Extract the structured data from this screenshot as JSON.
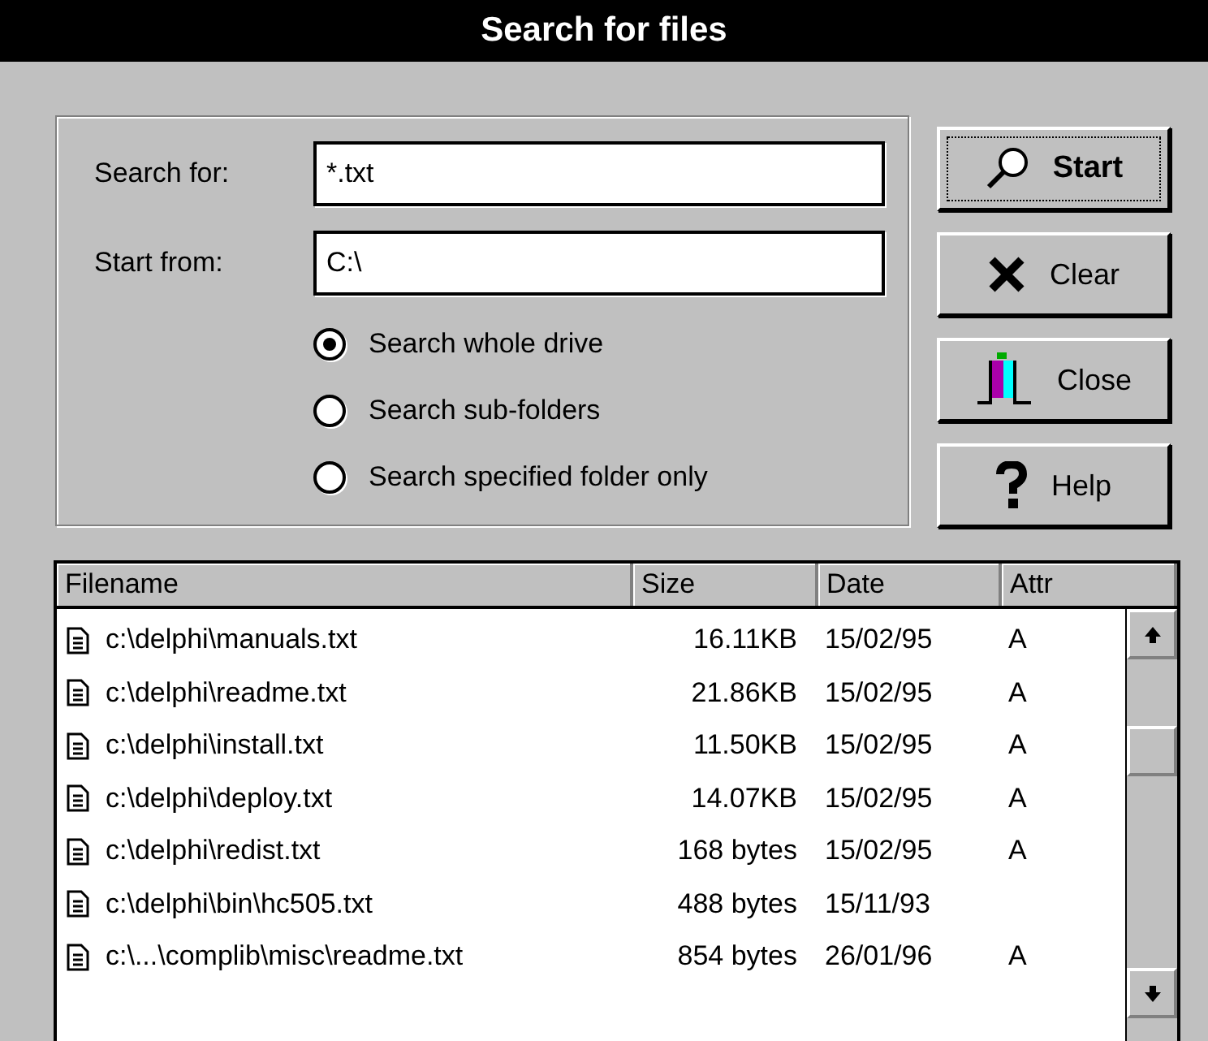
{
  "window": {
    "title": "Search for files"
  },
  "fields": [
    {
      "label": "Search for:",
      "value": "*.txt"
    },
    {
      "label": "Start from:",
      "value": "C:\\"
    }
  ],
  "options": [
    {
      "label": "Search whole drive",
      "selected": true
    },
    {
      "label": "Search sub-folders",
      "selected": false
    },
    {
      "label": "Search specified folder only",
      "selected": false
    }
  ],
  "buttons": [
    {
      "label": "Start",
      "kind": "search",
      "default": true
    },
    {
      "label": "Clear",
      "kind": "clear",
      "default": false
    },
    {
      "label": "Close",
      "kind": "close",
      "default": false
    },
    {
      "label": "Help",
      "kind": "help",
      "default": false
    }
  ],
  "table": {
    "columns": [
      "Filename",
      "Size",
      "Date",
      "Attr"
    ],
    "rows": [
      [
        "c:\\delphi\\manuals.txt",
        "16.11KB",
        "15/02/95",
        "A"
      ],
      [
        "c:\\delphi\\readme.txt",
        "21.86KB",
        "15/02/95",
        "A"
      ],
      [
        "c:\\delphi\\install.txt",
        "11.50KB",
        "15/02/95",
        "A"
      ],
      [
        "c:\\delphi\\deploy.txt",
        "14.07KB",
        "15/02/95",
        "A"
      ],
      [
        "c:\\delphi\\redist.txt",
        "168 bytes",
        "15/02/95",
        "A"
      ],
      [
        "c:\\delphi\\bin\\hc505.txt",
        "488 bytes",
        "15/11/93",
        ""
      ],
      [
        "c:\\...\\complib\\misc\\readme.txt",
        "854 bytes",
        "26/01/96",
        "A"
      ]
    ]
  }
}
